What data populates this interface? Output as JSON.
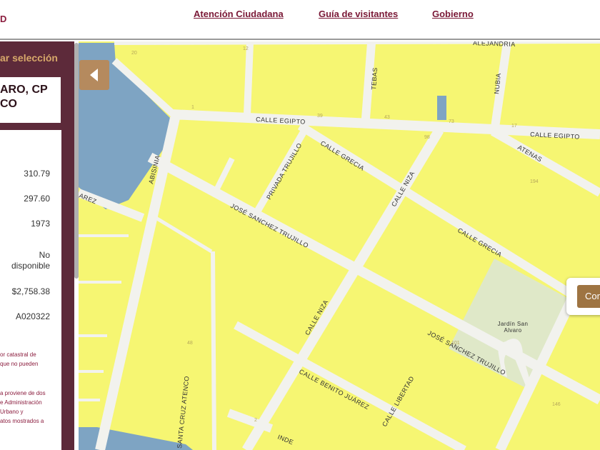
{
  "header": {
    "brand_fragment": "D",
    "nav": [
      {
        "label": "Atención Ciudadana"
      },
      {
        "label": "Guía de visitantes"
      },
      {
        "label": "Gobierno"
      }
    ]
  },
  "sidebar": {
    "selection_label": "ar selección",
    "address_lines": [
      "ARO, CP",
      "CO"
    ],
    "values": [
      "310.79",
      "297.60",
      "1973",
      "No disponible",
      "$2,758.38",
      "A020322"
    ],
    "note1": [
      "or catastral de",
      "que no pueden"
    ],
    "note2": [
      "a proviene de dos",
      "e Administración",
      "Urbano y",
      "atos mostrados a"
    ]
  },
  "map": {
    "toggle_icon": "chevron-left-icon",
    "popup_button": "Con",
    "colors": {
      "block": "#f6f672",
      "water": "#7ea4c3",
      "park": "#dfe8c8",
      "street": "#f2f2ee",
      "sidebar": "#5d2a3a",
      "accent": "#9e7442"
    },
    "streets": [
      {
        "name": "ALEJANDRIA"
      },
      {
        "name": "CALLE EGIPTO"
      },
      {
        "name": "CALLE EGIPTO"
      },
      {
        "name": "TEBAS"
      },
      {
        "name": "NUBIA"
      },
      {
        "name": "ABISINIA"
      },
      {
        "name": "PRIVADA TRUJILLO"
      },
      {
        "name": "CALLE GRECIA"
      },
      {
        "name": "ATENAS"
      },
      {
        "name": "CALLE NIZA"
      },
      {
        "name": "JOSÉ SANCHEZ TRUJILLO"
      },
      {
        "name": "CALLE GRECIA"
      },
      {
        "name": "AREZ"
      },
      {
        "name": "CALLE NIZA"
      },
      {
        "name": "JOSÉ SANCHEZ TRUJILLO"
      },
      {
        "name": "CALLE BENITO JUÁREZ"
      },
      {
        "name": "CALLE LIBERTAD"
      },
      {
        "name": "SANTA CRUZ ATENCO"
      },
      {
        "name": "INDE"
      }
    ],
    "park_name": [
      "Jardín San",
      "Alvaro"
    ],
    "lot_numbers": [
      "20",
      "12",
      "1",
      "39",
      "43",
      "73",
      "17",
      "98",
      "101",
      "146",
      "194",
      "2",
      "48"
    ]
  }
}
